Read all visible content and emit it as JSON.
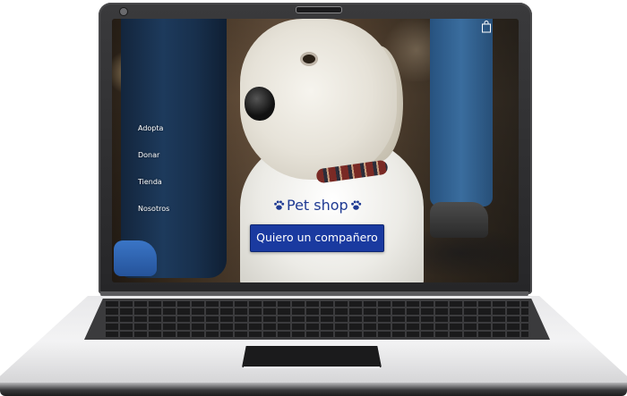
{
  "website": {
    "brand": "Pet shop",
    "nav": [
      {
        "label": "Adopta"
      },
      {
        "label": "Donar"
      },
      {
        "label": "Tienda"
      },
      {
        "label": "Nosotros"
      }
    ],
    "cta_label": "Quiero un compañero",
    "cart_icon": "shopping-bag-icon",
    "paw_icon": "paw-icon"
  },
  "colors": {
    "brand_blue": "#1f3a93",
    "button_blue": "#1a3aa0",
    "laptop_frame": "#2b2b2d",
    "keyboard": "#1a1a1b"
  }
}
